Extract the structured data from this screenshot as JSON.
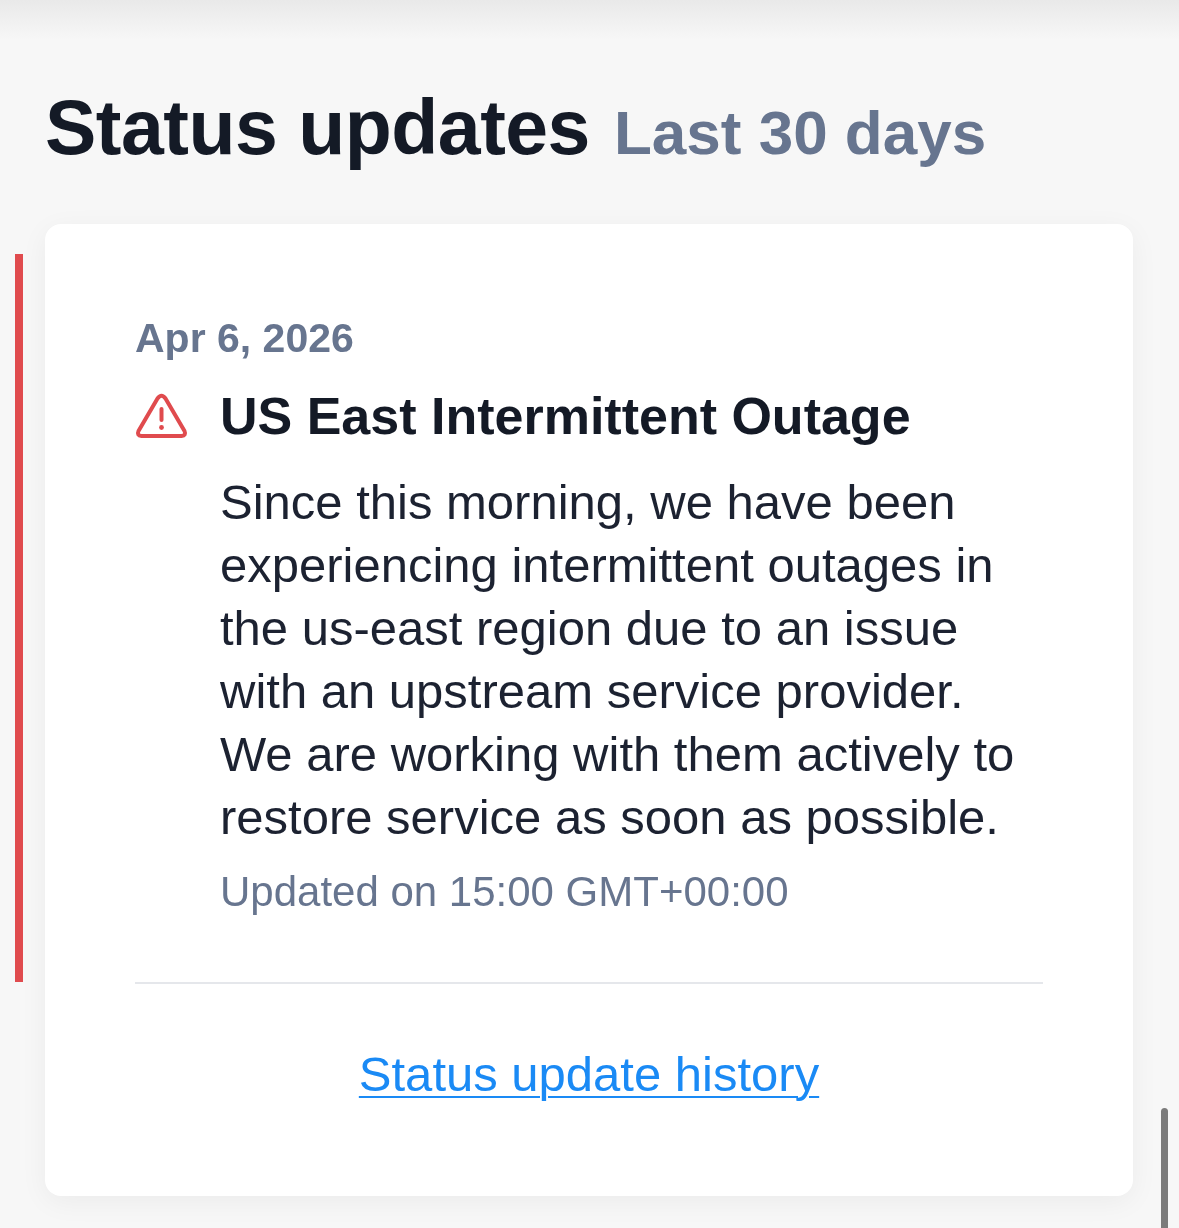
{
  "header": {
    "title": "Status updates",
    "period": "Last 30 days"
  },
  "incidents": [
    {
      "date": "Apr 6, 2026",
      "color": "#e04b4e",
      "title": "US East Intermittent Outage",
      "description": "Since this morning, we have been experiencing intermittent outages in the us-east region due to an issue with an upstream service provider. We are working with them actively to restore service as soon as possible.",
      "updated": "Updated on 15:00 GMT+00:00"
    }
  ],
  "history_link": "Status update history"
}
